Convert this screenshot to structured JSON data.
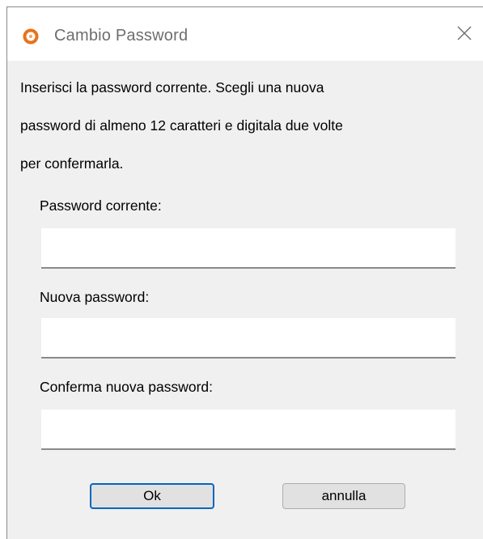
{
  "window": {
    "title": "Cambio Password",
    "app_icon": "orange-ring-logo-icon",
    "close_icon": "close-icon"
  },
  "instructions": {
    "line1": "Inserisci la password corrente. Scegli una nuova",
    "line2": "password di almeno 12 caratteri e digitala due volte",
    "line3": "per confermarla."
  },
  "fields": {
    "current": {
      "label": "Password corrente:",
      "value": ""
    },
    "new": {
      "label": "Nuova password:",
      "value": ""
    },
    "confirm": {
      "label": "Conferma nuova password:",
      "value": ""
    }
  },
  "buttons": {
    "ok_label": "Ok",
    "cancel_label": "annulla"
  },
  "colors": {
    "accent": "#0067c0",
    "logo": "#e8731c",
    "dialog_background": "#f0f0f0"
  }
}
